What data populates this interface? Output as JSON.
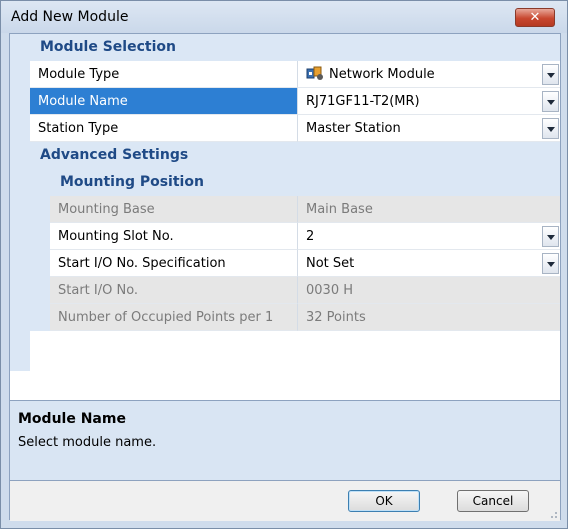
{
  "window": {
    "title": "Add New Module",
    "close_label": "✕"
  },
  "grid": {
    "section_module_selection": "Module Selection",
    "module_type": {
      "label": "Module Type",
      "value": "Network Module",
      "icon": "network-module-icon"
    },
    "module_name": {
      "label": "Module Name",
      "value": "RJ71GF11-T2(MR)"
    },
    "station_type": {
      "label": "Station Type",
      "value": "Master Station"
    },
    "section_advanced": "Advanced Settings",
    "section_mounting": "Mounting Position",
    "mounting_base": {
      "label": "Mounting Base",
      "value": "Main Base"
    },
    "mounting_slot": {
      "label": "Mounting Slot No.",
      "value": "2"
    },
    "start_io_spec": {
      "label": "Start I/O No. Specification",
      "value": "Not Set"
    },
    "start_io": {
      "label": "Start I/O No.",
      "value": "0030 H"
    },
    "occupied_points": {
      "label": "Number of Occupied Points per 1",
      "value": "32 Points"
    }
  },
  "description": {
    "title": "Module Name",
    "text": "Select module name."
  },
  "buttons": {
    "ok": "OK",
    "cancel": "Cancel"
  },
  "colors": {
    "selection": "#2d7fd3",
    "category_text": "#1f4a86",
    "category_bg": "#dbe7f5"
  }
}
